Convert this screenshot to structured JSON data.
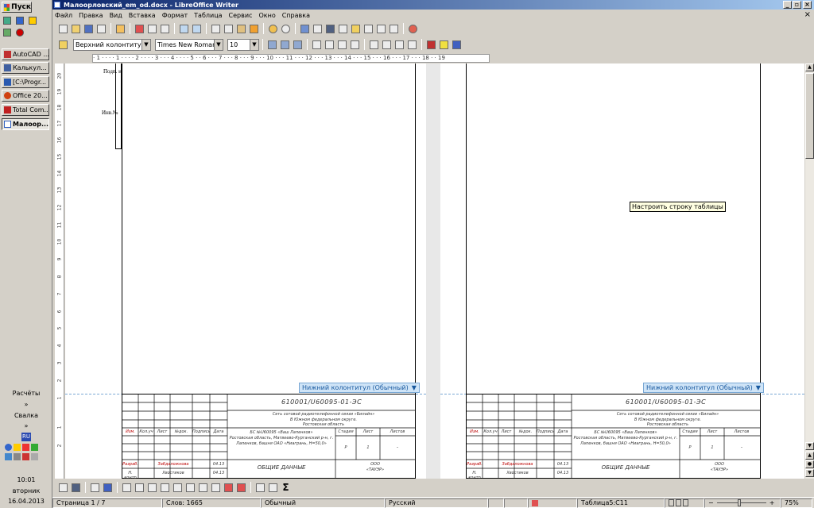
{
  "taskbar": {
    "start_label": "Пуск",
    "tasks": [
      {
        "label": "AutoCAD ...",
        "color": "#c03030"
      },
      {
        "label": "Калькул...",
        "color": "#4060a0"
      },
      {
        "label": "[C:\\Progr...",
        "color": "#2a5ab0"
      },
      {
        "label": "Office 20...",
        "color": "#d04010"
      },
      {
        "label": "Total Com...",
        "color": "#c02020"
      },
      {
        "label": "Малоор...",
        "color": "#3060c0"
      }
    ],
    "links": [
      "Расчёты",
      "»",
      "Свалка",
      "»"
    ],
    "lang": "RU",
    "clock_time": "10:01",
    "clock_day": "вторник",
    "clock_date": "16.04.2013"
  },
  "window": {
    "title": "Малоорловский_em_od.docx - LibreOffice Writer",
    "btn_min": "_",
    "btn_max": "▫",
    "btn_close": "×",
    "doc_close": "×"
  },
  "menu": [
    "Файл",
    "Правка",
    "Вид",
    "Вставка",
    "Формат",
    "Таблица",
    "Сервис",
    "Окно",
    "Справка"
  ],
  "format_bar": {
    "style": "Верхний колонтитул",
    "font": "Times New Roman",
    "size": "10"
  },
  "ruler": {
    "h_text": "· 1 · · · · 1 · · · · 2 · · · · 3 · · · 4 · · · · 5 · · 6 · · · 7 · · · 8 · · · 9 · · · 10 · · · 11 · · · 12 · · · 13 · · · 14 · · · 15 · · · 16 · · · 17 · · · 18 · · 19",
    "v_ticks": [
      "20",
      "19",
      "18",
      "17",
      "16",
      "15",
      "14",
      "13",
      "12",
      "11",
      "10",
      "9",
      "8",
      "7",
      "6",
      "5",
      "4",
      "3",
      "2",
      "1",
      "1",
      "2"
    ]
  },
  "document": {
    "side_label1": "Подп. и",
    "side_label2": "Инв.№",
    "footer_label": "Нижний колонтитул (Обычный)",
    "tooltip": "Настроить строку таблицы",
    "stamp": {
      "doc_code": "610001/U60095-01-ЭС",
      "line1": "Сеть сотовой радиотелефонной связи «Билайн»",
      "line2": "В Южном федеральном округе.",
      "line3": "Ростовская область",
      "object_line1": "БС №U60095 «Ваш Лапенков»",
      "object_line2": "Ростовская область, Матвеево-Курганский р-н, г.",
      "object_line3": "Лапенков, башня ОАО «Ниагрань, Н=50,0»",
      "stage_hdr": "Стадия",
      "sheet_hdr": "Лист",
      "sheets_hdr": "Листов",
      "stage": "Р",
      "sheet": "1",
      "sheets": "–",
      "name": "ОБЩИЕ ДАННЫЕ",
      "org1": "ООО",
      "org2": "«ТАУЭР»",
      "hdr_cols": [
        "Изм.",
        "Кол.уч",
        "Лист",
        "№док.",
        "Подпись",
        "Дата"
      ],
      "role1": "Разраб.",
      "person1": "Забдаложнова",
      "date1": "04.13",
      "role2": "Н. контр",
      "person2": "Хвостиков",
      "date2": "04.13"
    }
  },
  "status": {
    "page": "Страница 1 / 7",
    "words": "Слов: 1665",
    "style": "Обычный",
    "lang": "Русский",
    "cell": "Таблица5:C11",
    "zoom": "75%"
  }
}
